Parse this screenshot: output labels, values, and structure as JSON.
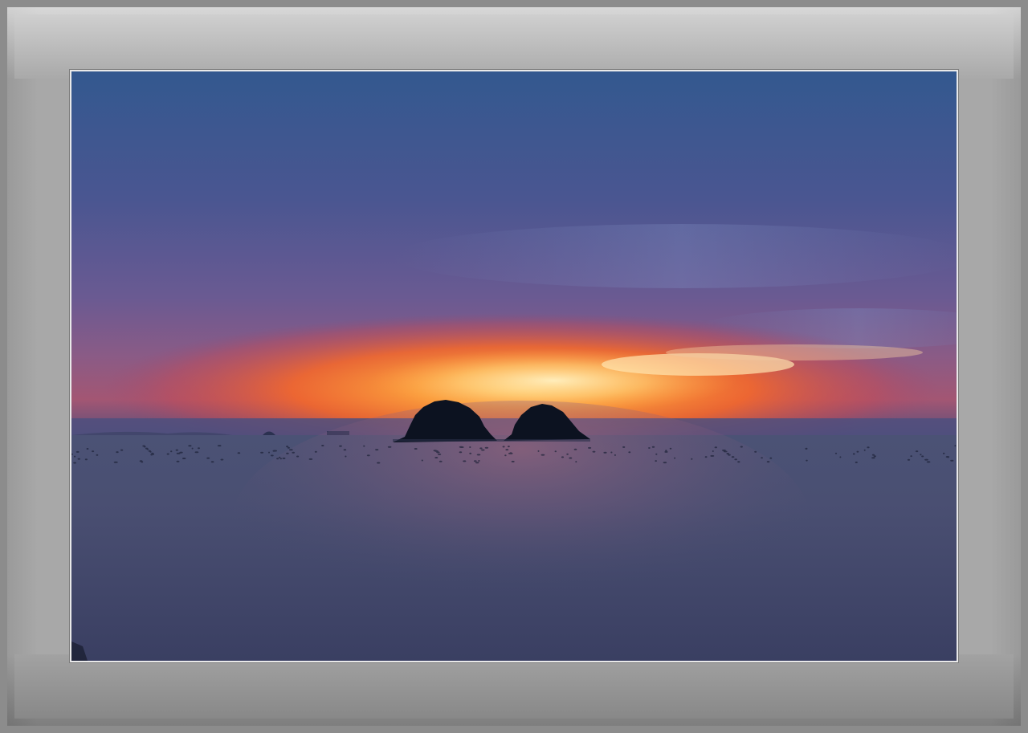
{
  "image": {
    "subject": "sunset-over-sea-with-two-islands",
    "colors": {
      "sky_top": "#33588f",
      "sky_mid": "#5d5c95",
      "sky_glow": "#ff7a1f",
      "sky_glow_core": "#ffd27a",
      "horizon_haze": "#4d4f7e",
      "sea_top": "#464d73",
      "sea_bottom": "#3a3f64",
      "island": "#0c1220",
      "frame_light": "#cfcfcf",
      "frame_dark": "#888888",
      "mat_border": "#e9e9e9"
    }
  }
}
